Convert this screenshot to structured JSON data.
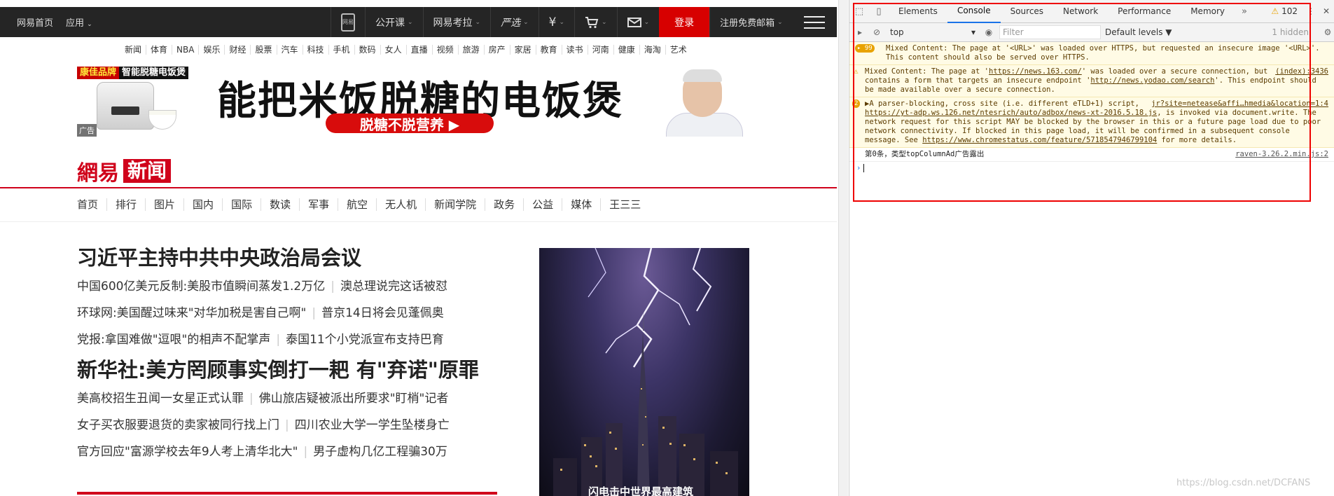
{
  "topbar": {
    "left": [
      "网易首页",
      "应用"
    ],
    "items": [
      {
        "label": "网易",
        "icon": "phone-icon"
      },
      {
        "label": "公开课"
      },
      {
        "label": "网易考拉"
      },
      {
        "label": "严选"
      },
      {
        "label": "¥"
      },
      {
        "label": "购物车"
      },
      {
        "label": "邮箱"
      }
    ],
    "login": "登录",
    "register": "注册免费邮箱"
  },
  "channels": [
    "新闻",
    "体育",
    "NBA",
    "娱乐",
    "财经",
    "股票",
    "汽车",
    "科技",
    "手机",
    "数码",
    "女人",
    "直播",
    "视频",
    "旅游",
    "房产",
    "家居",
    "教育",
    "读书",
    "河南",
    "健康",
    "海淘",
    "艺术"
  ],
  "ad": {
    "brand_1": "康佳品牌",
    "brand_2": "智能脱糖电饭煲",
    "headline": "能把米饭脱糖的电饭煲",
    "pill": "脱糖不脱营养 ▶",
    "tag": "广告"
  },
  "logo": {
    "wy": "網易",
    "xw": "新闻"
  },
  "mainnav": [
    "首页",
    "排行",
    "图片",
    "国内",
    "国际",
    "数读",
    "军事",
    "航空",
    "无人机",
    "新闻学院",
    "政务",
    "公益",
    "媒体",
    "王三三"
  ],
  "news": {
    "headline_1": "习近平主持中共中央政治局会议",
    "rows_1": [
      [
        "中国600亿美元反制:美股市值瞬间蒸发1.2万亿",
        "澳总理说完这话被怼"
      ],
      [
        "环球网:美国醒过味来\"对华加税是害自己啊\"",
        "普京14日将会见蓬佩奥"
      ],
      [
        "党报:拿国难做\"逗哏\"的相声不配掌声",
        "泰国11个小党派宣布支持巴育"
      ]
    ],
    "headline_2": "新华社:美方罔顾事实倒打一耙 有\"弃诺\"原罪",
    "rows_2": [
      [
        "美高校招生丑闻一女星正式认罪",
        "佛山旅店疑被派出所要求\"盯梢\"记者"
      ],
      [
        "女子买衣服要退货的卖家被同行找上门",
        "四川农业大学一学生坠楼身亡"
      ],
      [
        "官方回应\"富源学校去年9人考上清华北大\"",
        "男子虚构几亿工程骗30万"
      ]
    ],
    "photo_caption": "闪电击中世界最高建筑"
  },
  "devtools": {
    "tabs": [
      "Elements",
      "Console",
      "Sources",
      "Network",
      "Performance",
      "Memory"
    ],
    "active_tab": "Console",
    "warning_count": "102",
    "context": "top",
    "filter_placeholder": "Filter",
    "levels": "Default levels ▼",
    "hidden": "1 hidden",
    "messages": [
      {
        "badge": "99",
        "text": "Mixed Content: The page at '<URL>' was loaded over HTTPS, but requested an insecure image '<URL>'. This content should also be served over HTTPS.",
        "src": ""
      },
      {
        "text_1": "Mixed Content: The page at '",
        "link_1": "https://news.163.com/",
        "text_2": "' was loaded over a secure connection, but contains a form that targets an insecure endpoint '",
        "link_2": "http://news.yodao.com/search",
        "text_3": "'. This endpoint should be made available over a secure connection.",
        "src": "(index):3436"
      },
      {
        "badge": "2",
        "text_1": "▶A parser-blocking, cross site (i.e. different eTLD+1) script, ",
        "link_1": "https://yt-adp.ws.126.net/ntesrich/auto/adbox/news-xt-2016.5.18.js",
        "text_2": ", is invoked via document.write. The network request for this script MAY be blocked by the browser in this or a future page load due to poor network connectivity. If blocked in this page load, it will be confirmed in a subsequent console message. See ",
        "link_2": "https://www.chromestatus.com/feature/5718547946799104",
        "text_3": " for more details.",
        "src": "jr?site=netease&affi…hmedia&location=1:4"
      }
    ],
    "log": {
      "text": "第0条，类型topColumnAd广告露出",
      "src": "raven-3.26.2.min.js:2"
    }
  },
  "watermark": "https://blog.csdn.net/DCFANS",
  "colors": {
    "accent_red": "#d0021b",
    "topbar_bg": "#252525",
    "warn_bg": "#fffbe5",
    "devtools_blue": "#1a73e8"
  }
}
